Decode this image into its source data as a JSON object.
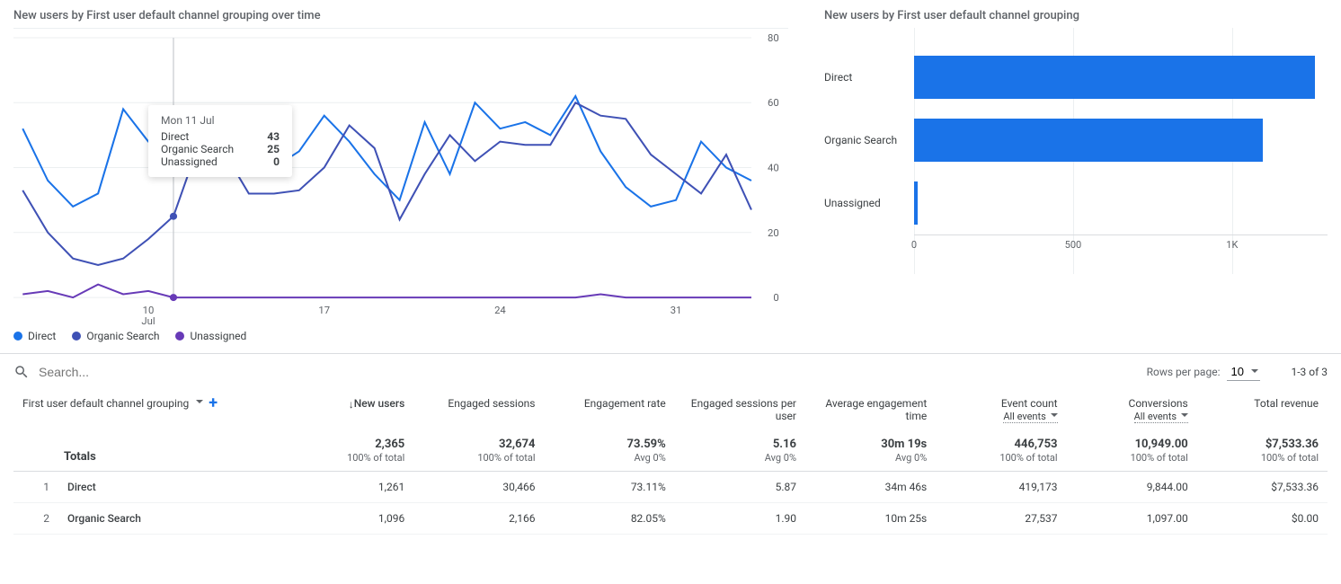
{
  "chart_data": [
    {
      "type": "line",
      "title": "New users by First user default channel grouping over time",
      "xlabel": "Jul",
      "ylabel": "",
      "ylim": [
        0,
        80
      ],
      "y_ticks": [
        0,
        20,
        40,
        60,
        80
      ],
      "x_ticks": [
        "10",
        "17",
        "24",
        "31"
      ],
      "x": [
        5,
        6,
        7,
        8,
        9,
        10,
        11,
        12,
        13,
        14,
        15,
        16,
        17,
        18,
        19,
        20,
        21,
        22,
        23,
        24,
        25,
        26,
        27,
        28,
        29,
        30,
        31,
        32,
        33,
        34
      ],
      "series": [
        {
          "name": "Direct",
          "color": "#1a73e8",
          "values": [
            52,
            36,
            28,
            32,
            58,
            48,
            43,
            48,
            39,
            42,
            40,
            45,
            56,
            48,
            38,
            30,
            54,
            38,
            60,
            52,
            54,
            50,
            62,
            45,
            34,
            28,
            30,
            48,
            40,
            36
          ]
        },
        {
          "name": "Organic Search",
          "color": "#3f51b5",
          "values": [
            33,
            20,
            12,
            10,
            12,
            18,
            25,
            47,
            45,
            32,
            32,
            33,
            40,
            53,
            46,
            24,
            38,
            50,
            42,
            48,
            47,
            47,
            60,
            56,
            55,
            44,
            38,
            32,
            44,
            27
          ]
        },
        {
          "name": "Unassigned",
          "color": "#673ab7",
          "values": [
            1,
            2,
            0,
            4,
            1,
            2,
            0,
            0,
            0,
            0,
            0,
            0,
            0,
            0,
            0,
            0,
            0,
            0,
            0,
            0,
            0,
            0,
            0,
            1,
            0,
            0,
            0,
            0,
            0,
            0
          ]
        }
      ],
      "tooltip": {
        "date": "Mon 11 Jul",
        "x_index_label": "11",
        "rows": [
          {
            "label": "Direct",
            "value": "43"
          },
          {
            "label": "Organic Search",
            "value": "25"
          },
          {
            "label": "Unassigned",
            "value": "0"
          }
        ]
      },
      "legend": [
        "Direct",
        "Organic Search",
        "Unassigned"
      ]
    },
    {
      "type": "bar",
      "orientation": "horizontal",
      "title": "New users by First user default channel grouping",
      "categories": [
        "Direct",
        "Organic Search",
        "Unassigned"
      ],
      "values": [
        1261,
        1096,
        8
      ],
      "xlim": [
        0,
        1300
      ],
      "x_ticks": [
        0,
        500,
        1000
      ],
      "x_tick_labels": [
        "0",
        "500",
        "1K"
      ]
    }
  ],
  "legend_colors": [
    "#1a73e8",
    "#3f51b5",
    "#673ab7"
  ],
  "search": {
    "placeholder": "Search..."
  },
  "pager": {
    "rows_per_page_label": "Rows per page:",
    "rows_per_page_value": "10",
    "range": "1-3 of 3"
  },
  "table": {
    "dimension_label": "First user default channel grouping",
    "columns": [
      {
        "label": "New users",
        "sorted": true
      },
      {
        "label": "Engaged sessions"
      },
      {
        "label": "Engagement rate"
      },
      {
        "label": "Engaged sessions per user"
      },
      {
        "label": "Average engagement time"
      },
      {
        "label": "Event count",
        "sub": "All events"
      },
      {
        "label": "Conversions",
        "sub": "All events"
      },
      {
        "label": "Total revenue"
      }
    ],
    "totals_label": "Totals",
    "totals": [
      {
        "big": "2,365",
        "small": "100% of total"
      },
      {
        "big": "32,674",
        "small": "100% of total"
      },
      {
        "big": "73.59%",
        "small": "Avg 0%"
      },
      {
        "big": "5.16",
        "small": "Avg 0%"
      },
      {
        "big": "30m 19s",
        "small": "Avg 0%"
      },
      {
        "big": "446,753",
        "small": "100% of total"
      },
      {
        "big": "10,949.00",
        "small": "100% of total"
      },
      {
        "big": "$7,533.36",
        "small": "100% of total"
      }
    ],
    "rows": [
      {
        "idx": "1",
        "dim": "Direct",
        "cells": [
          "1,261",
          "30,466",
          "73.11%",
          "5.87",
          "34m 46s",
          "419,173",
          "9,844.00",
          "$7,533.36"
        ]
      },
      {
        "idx": "2",
        "dim": "Organic Search",
        "cells": [
          "1,096",
          "2,166",
          "82.05%",
          "1.90",
          "10m 25s",
          "27,537",
          "1,097.00",
          "$0.00"
        ]
      }
    ]
  }
}
